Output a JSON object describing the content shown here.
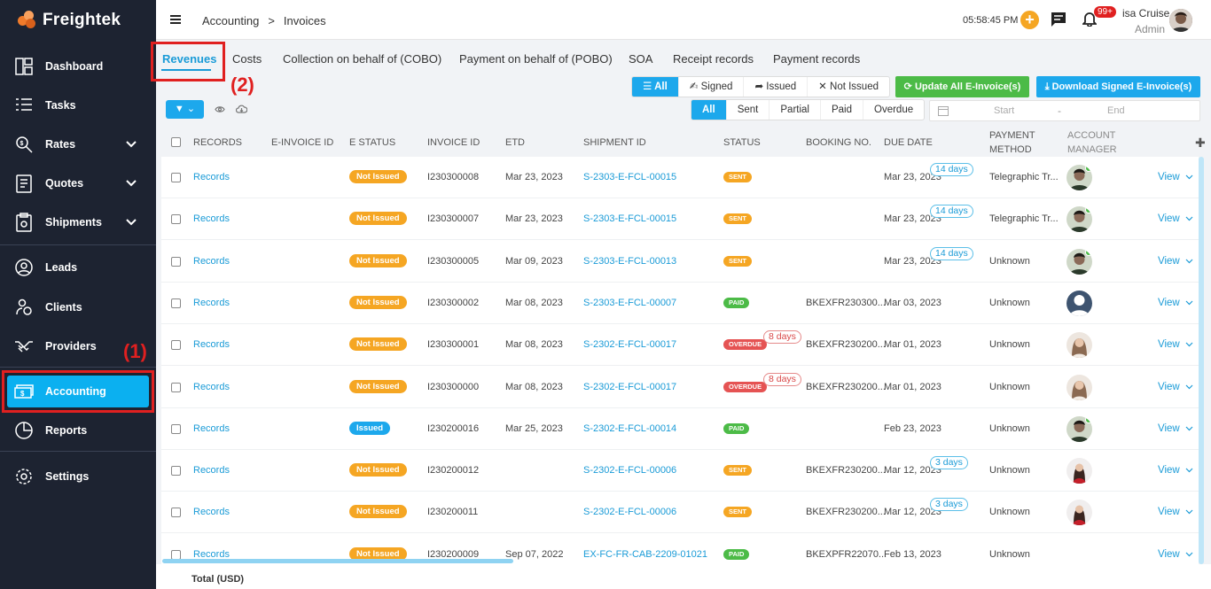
{
  "brand": {
    "name": "Freightek"
  },
  "sidebar": {
    "items": [
      {
        "label": "Dashboard",
        "icon": "dashboard-icon"
      },
      {
        "label": "Tasks",
        "icon": "tasks-icon"
      },
      {
        "label": "Rates",
        "icon": "rates-icon"
      },
      {
        "label": "Quotes",
        "icon": "quotes-icon"
      },
      {
        "label": "Shipments",
        "icon": "shipments-icon"
      },
      {
        "label": "Leads",
        "icon": "leads-icon"
      },
      {
        "label": "Clients",
        "icon": "clients-icon"
      },
      {
        "label": "Providers",
        "icon": "providers-icon"
      },
      {
        "label": "Accounting",
        "icon": "accounting-icon",
        "active": true
      },
      {
        "label": "Reports",
        "icon": "reports-icon"
      },
      {
        "label": "Settings",
        "icon": "gear-icon"
      }
    ]
  },
  "annotations": {
    "one": "(1)",
    "two": "(2)"
  },
  "header": {
    "breadcrumb": [
      "Accounting",
      ">",
      "Invoices"
    ],
    "time": "05:58:45 PM",
    "notif_badge": "99+",
    "user_name": "isa Cruise",
    "user_role": "Admin"
  },
  "tabs": [
    "Revenues",
    "Costs",
    "Collection on behalf of (COBO)",
    "Payment on behalf of (POBO)",
    "SOA",
    "Receipt records",
    "Payment records"
  ],
  "einvoice_filter": {
    "options": [
      "All",
      "Signed",
      "Issued",
      "Not Issued"
    ],
    "selected": "All"
  },
  "status_filter": {
    "options": [
      "All",
      "Sent",
      "Partial",
      "Paid",
      "Overdue"
    ],
    "selected": "All"
  },
  "buttons": {
    "update_all": "Update All E-Invoice(s)",
    "download_signed": "Download Signed E-Invoice(s)"
  },
  "date_range": {
    "start_placeholder": "Start",
    "dash": "-",
    "end_placeholder": "End"
  },
  "table": {
    "columns": [
      "RECORDS",
      "E-INVOICE ID",
      "E STATUS",
      "INVOICE ID",
      "ETD",
      "SHIPMENT ID",
      "STATUS",
      "BOOKING NO.",
      "DUE DATE",
      "PAYMENT METHOD",
      "ACCOUNT MANAGER"
    ],
    "view_label": "View",
    "rows": [
      {
        "records": "Records",
        "estatus": "Not Issued",
        "invoice_id": "I230300008",
        "etd": "Mar 23, 2023",
        "shipment": "S-2303-E-FCL-00015",
        "status": "SENT",
        "booking": "",
        "due": "Mar 23, 2023",
        "days": "14 days",
        "payment": "Telegraphic Tr...",
        "avatar": "m1"
      },
      {
        "records": "Records",
        "estatus": "Not Issued",
        "invoice_id": "I230300007",
        "etd": "Mar 23, 2023",
        "shipment": "S-2303-E-FCL-00015",
        "status": "SENT",
        "booking": "",
        "due": "Mar 23, 2023",
        "days": "14 days",
        "payment": "Telegraphic Tr...",
        "avatar": "m1"
      },
      {
        "records": "Records",
        "estatus": "Not Issued",
        "invoice_id": "I230300005",
        "etd": "Mar 09, 2023",
        "shipment": "S-2303-E-FCL-00013",
        "status": "SENT",
        "booking": "",
        "due": "Mar 23, 2023",
        "days": "14 days",
        "payment": "Unknown",
        "avatar": "m1"
      },
      {
        "records": "Records",
        "estatus": "Not Issued",
        "invoice_id": "I230300002",
        "etd": "Mar 08, 2023",
        "shipment": "S-2303-E-FCL-00007",
        "status": "PAID",
        "booking": "BKEXFR230300...",
        "due": "Mar 03, 2023",
        "days": "",
        "payment": "Unknown",
        "avatar": "blank"
      },
      {
        "records": "Records",
        "estatus": "Not Issued",
        "invoice_id": "I230300001",
        "etd": "Mar 08, 2023",
        "shipment": "S-2302-E-FCL-00017",
        "status": "OVERDUE",
        "overdue_days": "8 days",
        "booking": "BKEXFR230200...",
        "due": "Mar 01, 2023",
        "days": "",
        "payment": "Unknown",
        "avatar": "f1"
      },
      {
        "records": "Records",
        "estatus": "Not Issued",
        "invoice_id": "I230300000",
        "etd": "Mar 08, 2023",
        "shipment": "S-2302-E-FCL-00017",
        "status": "OVERDUE",
        "overdue_days": "8 days",
        "booking": "BKEXFR230200...",
        "due": "Mar 01, 2023",
        "days": "",
        "payment": "Unknown",
        "avatar": "f1"
      },
      {
        "records": "Records",
        "estatus": "Issued",
        "invoice_id": "I230200016",
        "etd": "Mar 25, 2023",
        "shipment": "S-2302-E-FCL-00014",
        "status": "PAID",
        "booking": "",
        "due": "Feb 23, 2023",
        "days": "",
        "payment": "Unknown",
        "avatar": "m1"
      },
      {
        "records": "Records",
        "estatus": "Not Issued",
        "invoice_id": "I230200012",
        "etd": "",
        "shipment": "S-2302-E-FCL-00006",
        "status": "SENT",
        "booking": "BKEXFR230200...",
        "due": "Mar 12, 2023",
        "days": "3 days",
        "payment": "Unknown",
        "avatar": "f2"
      },
      {
        "records": "Records",
        "estatus": "Not Issued",
        "invoice_id": "I230200011",
        "etd": "",
        "shipment": "S-2302-E-FCL-00006",
        "status": "SENT",
        "booking": "BKEXFR230200...",
        "due": "Mar 12, 2023",
        "days": "3 days",
        "payment": "Unknown",
        "avatar": "f2"
      },
      {
        "records": "Records",
        "estatus": "Not Issued",
        "invoice_id": "I230200009",
        "etd": "Sep 07, 2022",
        "shipment": "EX-FC-FR-CAB-2209-01021",
        "status": "PAID",
        "booking": "BKEXPFR22070...",
        "due": "Feb 13, 2023",
        "days": "",
        "payment": "Unknown",
        "avatar": "none"
      }
    ]
  },
  "footer": {
    "total_label": "Total (USD)"
  },
  "colors": {
    "sidebar_bg": "#1d2331",
    "accent": "#1da8ec",
    "orange": "#f5a623",
    "green": "#4cbb47",
    "red": "#e55353",
    "annotation": "#e02020"
  }
}
